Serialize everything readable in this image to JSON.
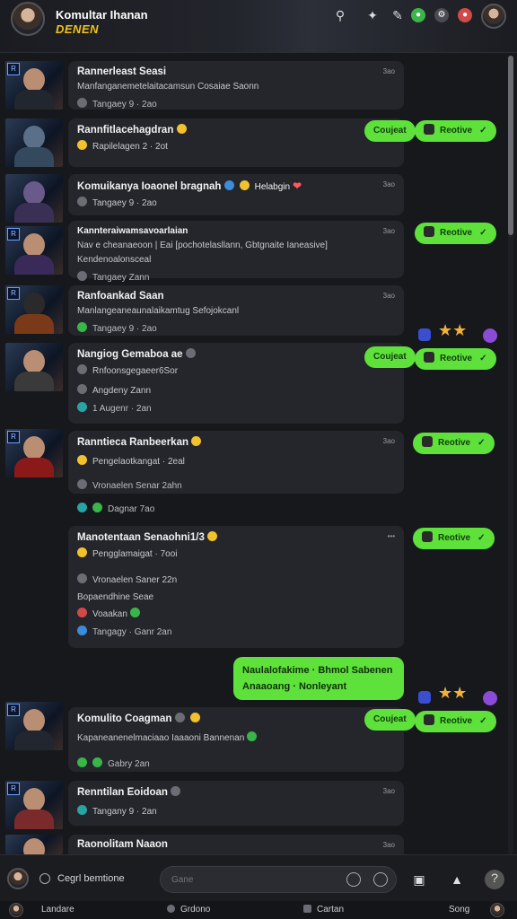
{
  "header": {
    "title": "Komultar Ihanan",
    "subtitle": "DENEN",
    "icons": [
      "search-icon",
      "puzzle-icon",
      "edit-icon",
      "green-status-icon",
      "settings-icon",
      "red-alert-icon"
    ]
  },
  "feed": [
    {
      "title": "Rannerleast Seasi",
      "line1": "Manfanganemetelaitacamsun Cosaiae Saonn",
      "meta": "Tangaey 9 · 2ao",
      "time": "3ao"
    },
    {
      "title": "Rannfitlacehagdran",
      "line1": "Rapilelagen 2 · 2ot",
      "time": ""
    },
    {
      "title": "Komuikanya Ioaonel bragnah",
      "title_suffix": "Helabgin",
      "line1": "Tangaey 9 · 2ao",
      "time": "3ao"
    },
    {
      "title": "Kannteraiwamsavoarlaian",
      "line1": "Nav e cheanaeoon | Eai [pochotelasllann, Gbtgnaite Ianeasive]",
      "line2": "Kendenoalonsceal",
      "meta": "Tangaey Zann",
      "time": "3ao"
    },
    {
      "title": "Ranfoankad Saan",
      "line1": "Manlangeaneaunalaikamtug Sefojokcanl",
      "meta": "Tangaey 9 · 2ao",
      "time": "3ao"
    },
    {
      "title": "Nangiog Gemaboa ae",
      "line1": "Rnfoonsgegaeer6Sor",
      "line2": "Angdeny Zann",
      "meta": "1 Augenr · 2an",
      "time": ""
    },
    {
      "title": "Ranntieca Ranbeerkan",
      "line1": "Pengelaotkangat · 2eal",
      "meta": "Vronaelen Senar 2ahn",
      "time": "3ao"
    },
    {
      "title": "Manotentaan Senaohni1/3",
      "line1": "Pengglamaigat · 7ooi",
      "line2": "Vronaelen Saner 22n",
      "line3": "Bopaendhine Seae",
      "line4": "Voaakan",
      "meta": "Tangagy · Ganr 2an",
      "time": "•••"
    },
    {
      "title": "Komulito Coagman",
      "line1": "Kapaneanenelmaciaao Iaaaoni Bannenan",
      "meta": "Gabry 2an",
      "time": ""
    },
    {
      "title": "Renntilan Eoidoan",
      "line1": "Tangany 9 · 2an",
      "time": "3ao"
    },
    {
      "title": "Raonolitam Naaon",
      "time": "3ao"
    }
  ],
  "standalone": "Dagnar 7ao",
  "reactions": {
    "label_a": "Coujeat",
    "label_b": "Reotive"
  },
  "green_card": {
    "line1": "Naulalofakime · Bhmol Sabenen",
    "line2": "Anaaoang · Nonleyant"
  },
  "composer": {
    "label": "Cegrl bemtione",
    "placeholder": "Gane"
  },
  "tabs": [
    "Landare",
    "Grdono",
    "Cartan",
    "Song"
  ]
}
